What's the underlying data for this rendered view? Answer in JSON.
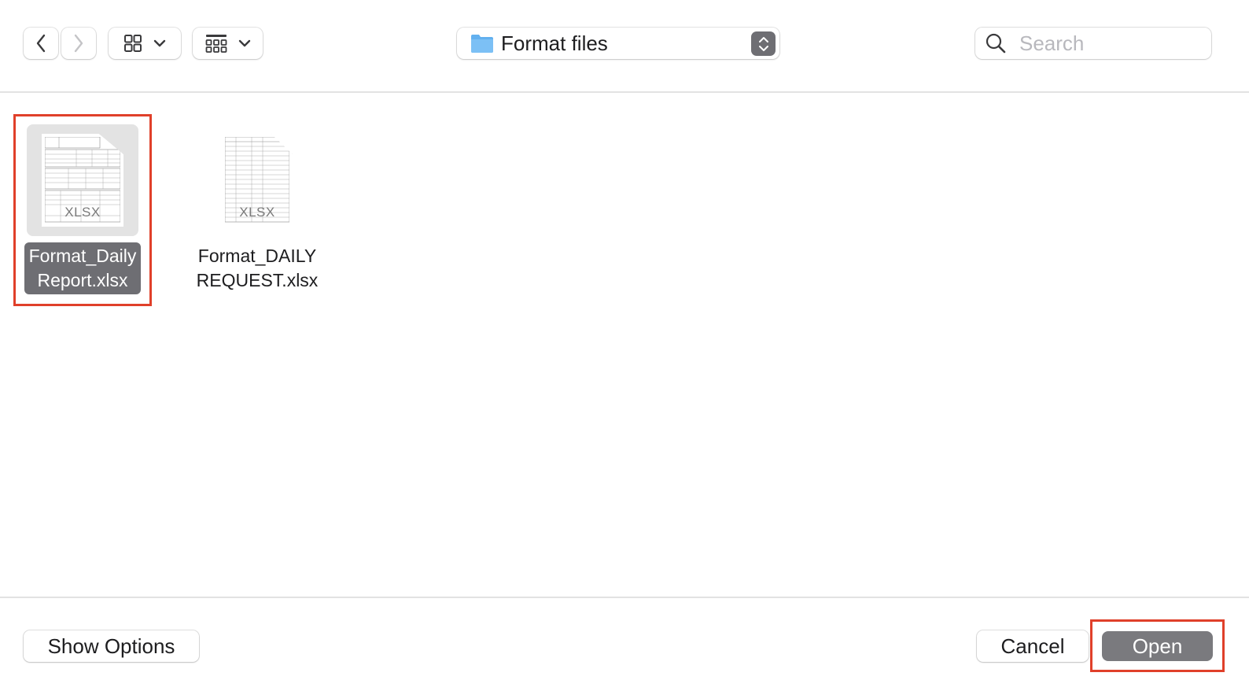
{
  "toolbar": {
    "back_icon": "chevron-left-icon",
    "forward_icon": "chevron-right-icon",
    "view_mode_icon": "icon-grid-icon",
    "group_mode_icon": "gallery-grid-icon",
    "location": "Format files",
    "search_placeholder": "Search"
  },
  "files": [
    {
      "name_line1": "Format_Daily",
      "name_line2": "Report.xlsx",
      "type_label": "XLSX",
      "selected": true
    },
    {
      "name_line1": "Format_DAILY",
      "name_line2": "REQUEST.xlsx",
      "type_label": "XLSX",
      "selected": false
    }
  ],
  "footer": {
    "show_options_label": "Show Options",
    "cancel_label": "Cancel",
    "open_label": "Open"
  },
  "colors": {
    "selection": "#6e6e73",
    "highlight_frame": "#e0402a",
    "folder": "#62b0ef"
  }
}
